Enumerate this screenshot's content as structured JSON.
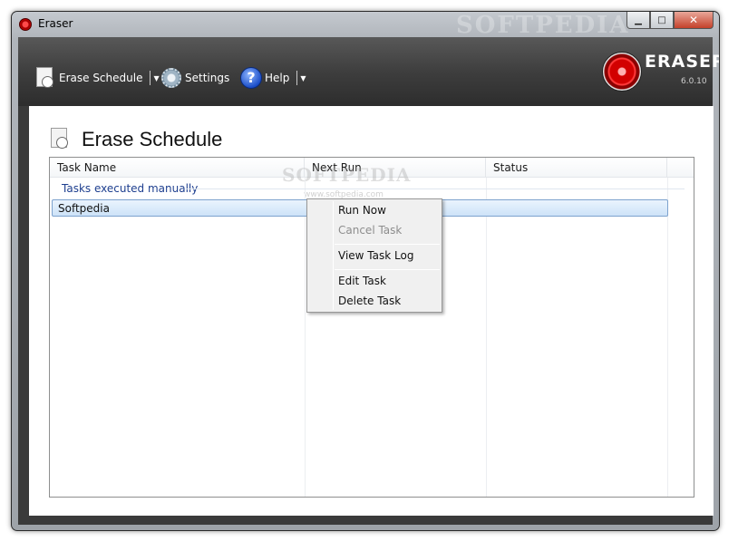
{
  "window": {
    "title": "Eraser",
    "watermark": "SOFTPEDIA"
  },
  "toolbar": {
    "erase_schedule": "Erase Schedule",
    "settings": "Settings",
    "help": "Help"
  },
  "brand": {
    "name": "ERASER",
    "version": "6.0.10"
  },
  "page": {
    "title": "Erase Schedule"
  },
  "list": {
    "columns": [
      "Task Name",
      "Next Run",
      "Status"
    ],
    "group_label": "Tasks executed manually",
    "rows": [
      {
        "task_name": "Softpedia",
        "next_run": "",
        "status": ""
      }
    ],
    "watermark": "SOFTPEDIA",
    "watermark_url": "www.softpedia.com"
  },
  "context_menu": {
    "items": [
      {
        "label": "Run Now",
        "enabled": true
      },
      {
        "label": "Cancel Task",
        "enabled": false
      },
      {
        "label": "View Task Log",
        "enabled": true
      },
      {
        "label": "Edit Task",
        "enabled": true
      },
      {
        "label": "Delete Task",
        "enabled": true
      }
    ]
  },
  "colors": {
    "toolbar_bg": "#3d3d3d",
    "group_label": "#1e3f8f",
    "selection": "#cde3f8",
    "close_button": "#c4412a",
    "brand_red": "#d20000"
  },
  "icons": {
    "app": "eraser-logo-icon",
    "erase_schedule": "document-clock-icon",
    "settings": "gear-icon",
    "help": "question-icon"
  }
}
